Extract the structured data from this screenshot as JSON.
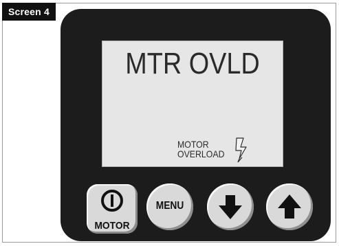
{
  "screen_tag": "Screen 4",
  "display": {
    "title": "MTR OVLD",
    "message_line1": "MOTOR",
    "message_line2": "OVERLOAD",
    "icon": "lightning-bolt-icon"
  },
  "buttons": {
    "motor": {
      "label": "MOTOR",
      "icon": "power-icon"
    },
    "menu": {
      "label": "MENU"
    },
    "down": {
      "icon": "arrow-down-icon"
    },
    "up": {
      "icon": "arrow-up-icon"
    }
  },
  "colors": {
    "panel": "#1c1c1c",
    "lcd_background": "#e6e6e6",
    "button_face": "#d9d9d9",
    "tag_background": "#111111"
  }
}
